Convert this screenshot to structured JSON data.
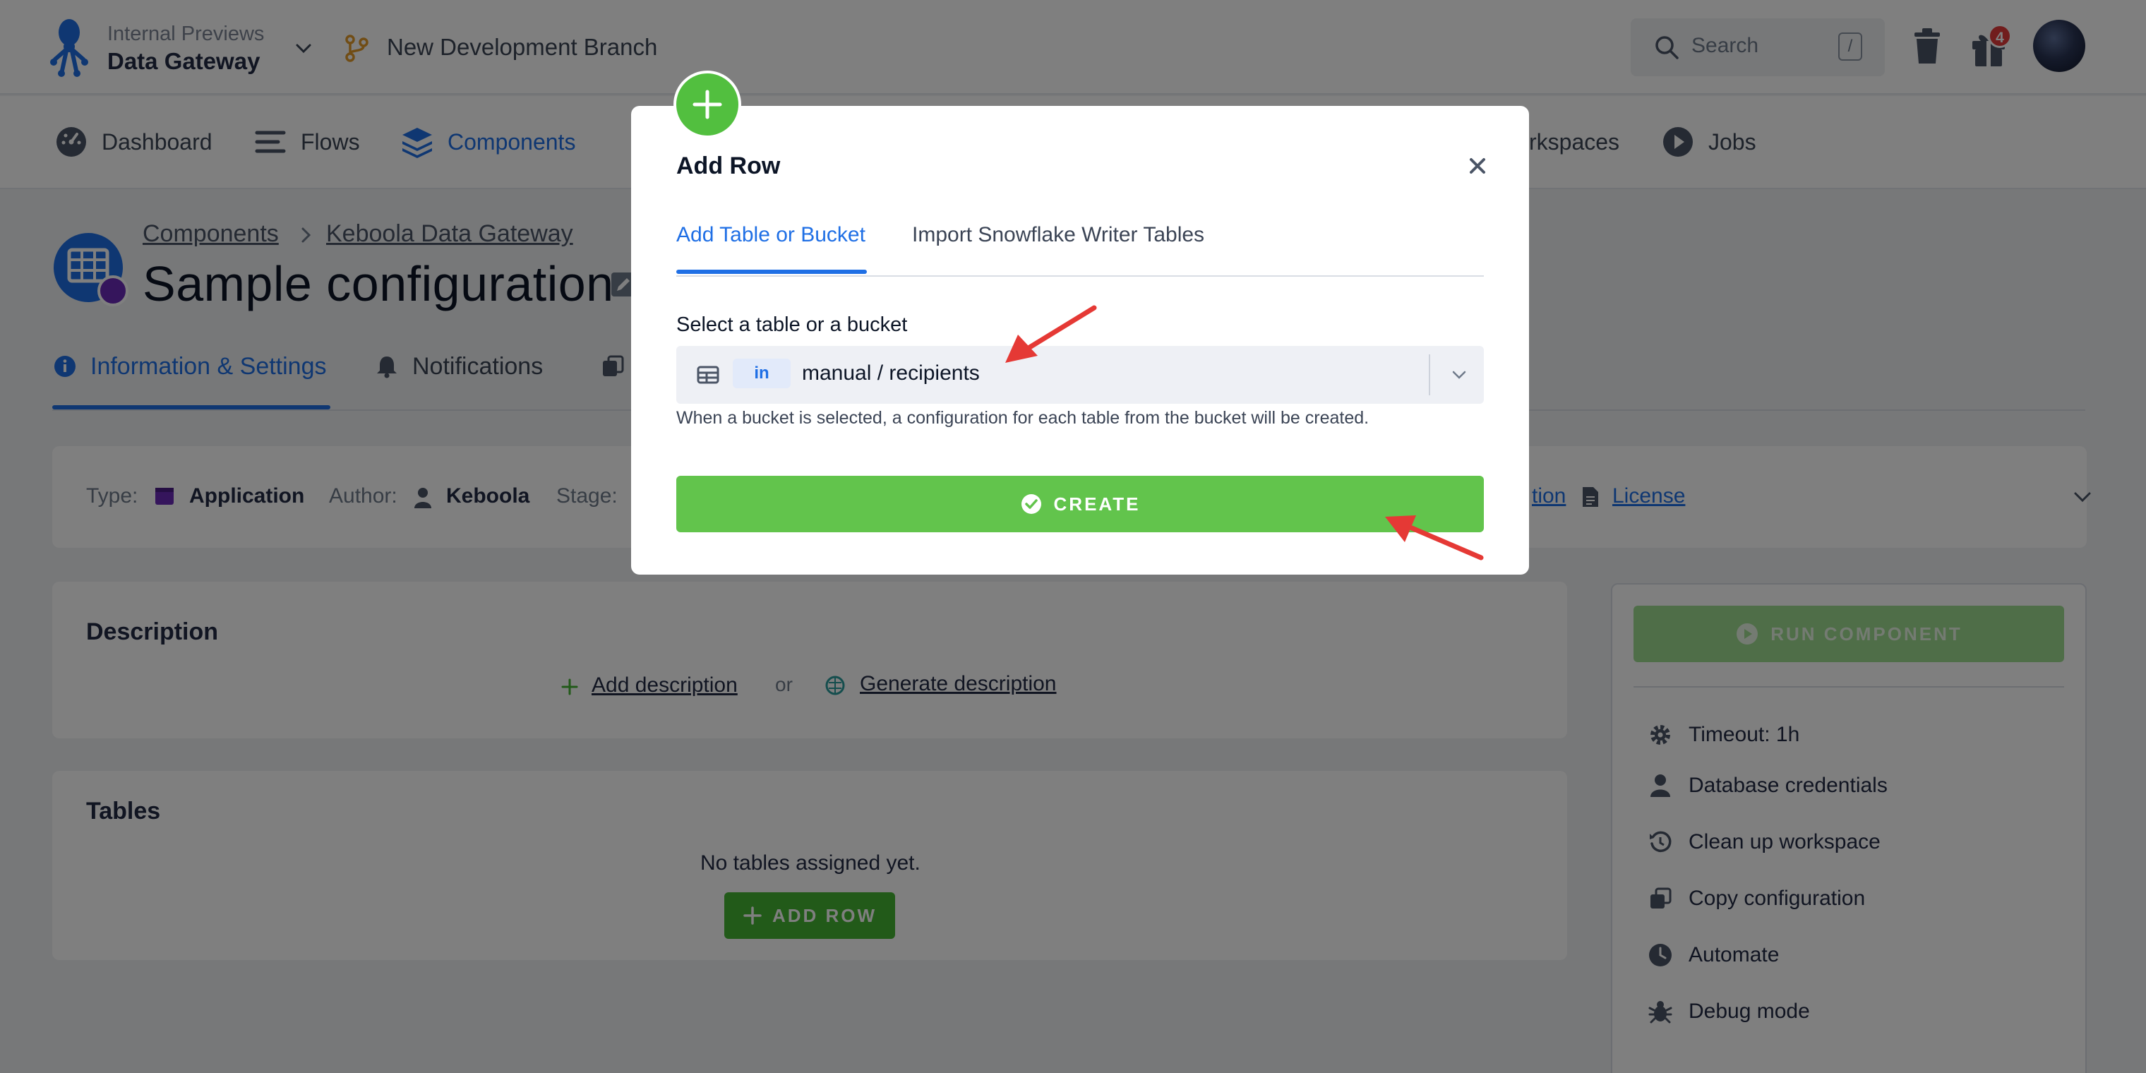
{
  "header": {
    "project_sub": "Internal Previews",
    "project_name": "Data Gateway",
    "branch": "New Development Branch",
    "search_placeholder": "Search",
    "search_shortcut": "/",
    "notifications_count": "4"
  },
  "nav": {
    "items": [
      {
        "label": "Dashboard",
        "icon": "dashboard-icon"
      },
      {
        "label": "Flows",
        "icon": "flows-icon"
      },
      {
        "label": "Components",
        "icon": "components-icon",
        "active": true
      },
      {
        "label": "rkspaces",
        "icon": "workspaces-icon"
      },
      {
        "label": "Jobs",
        "icon": "jobs-icon"
      }
    ]
  },
  "page": {
    "breadcrumb": [
      "Components",
      "Keboola Data Gateway"
    ],
    "title": "Sample configuration",
    "tabs": [
      "Information & Settings",
      "Notifications"
    ],
    "info": {
      "type_label": "Type:",
      "type_value": "Application",
      "author_label": "Author:",
      "author_value": "Keboola",
      "stage_label": "Stage:",
      "doc_link": "tion",
      "license_link": "License"
    },
    "description": {
      "title": "Description",
      "add_link": "Add description",
      "or": "or",
      "generate_link": "Generate description"
    },
    "tables": {
      "title": "Tables",
      "empty": "No tables assigned yet.",
      "add_row": "ADD ROW"
    },
    "sidebar": {
      "run": "RUN COMPONENT",
      "items": [
        "Timeout: 1h",
        "Database credentials",
        "Clean up workspace",
        "Copy configuration",
        "Automate",
        "Debug mode"
      ]
    }
  },
  "modal": {
    "title": "Add Row",
    "tabs": [
      "Add Table or Bucket",
      "Import Snowflake Writer Tables"
    ],
    "select_label": "Select a table or a bucket",
    "stage_badge": "in",
    "select_value": "manual / recipients",
    "help": "When a bucket is selected, a configuration for each table from the bucket will be created.",
    "create": "CREATE"
  },
  "colors": {
    "accent": "#1f6fe5",
    "green": "#62c44c",
    "annotation": "#e53935"
  }
}
